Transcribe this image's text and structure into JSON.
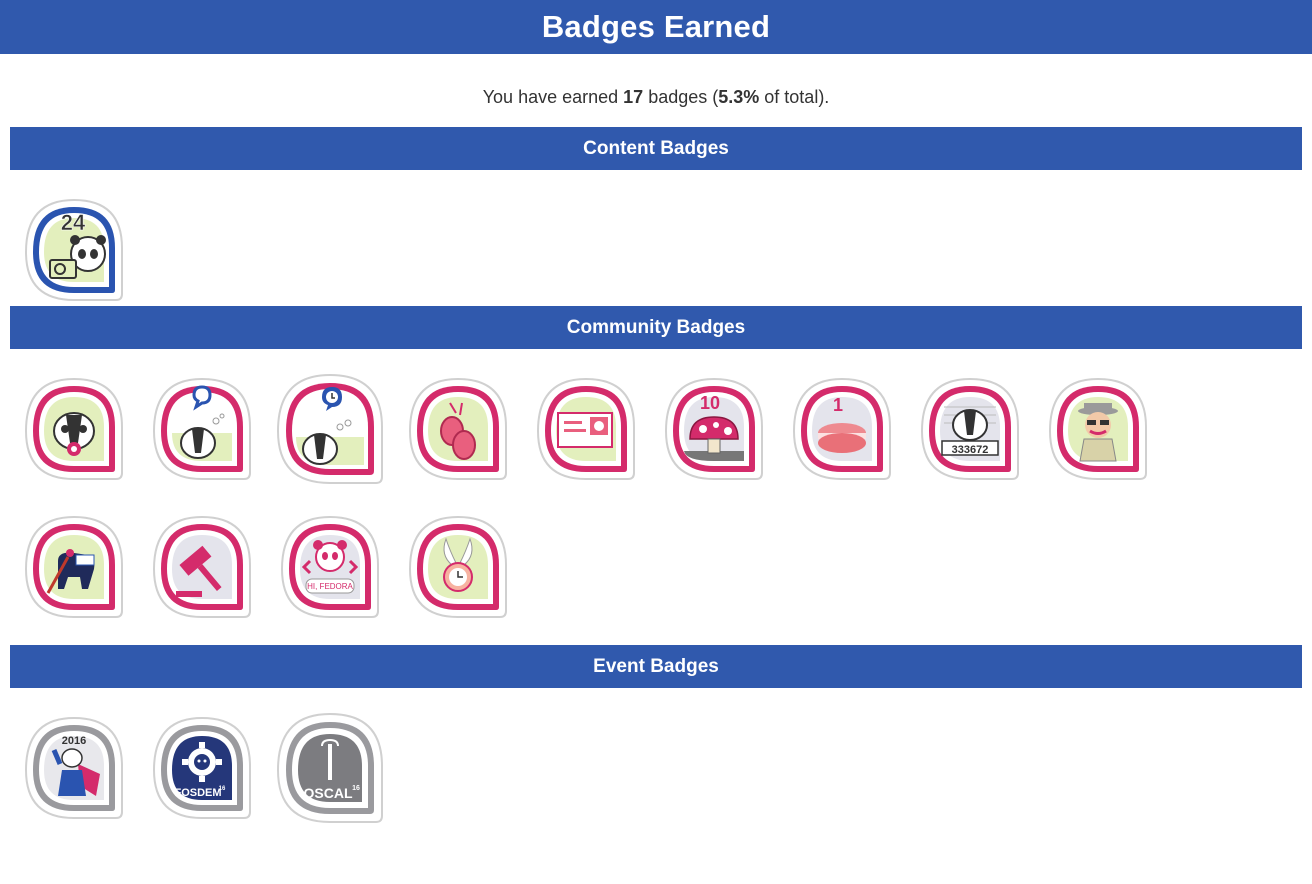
{
  "header": {
    "title": "Badges Earned"
  },
  "summary": {
    "prefix": "You have earned ",
    "count": "17",
    "middle": " badges (",
    "percent": "5.3%",
    "suffix": " of total)."
  },
  "sections": {
    "content": {
      "title": "Content Badges"
    },
    "community": {
      "title": "Community Badges"
    },
    "event": {
      "title": "Event Badges"
    }
  },
  "badge_text": {
    "camera_count": "24",
    "mushroom_count": "10",
    "macaron_count": "1",
    "mugshot_number": "333672",
    "hi_fedora": "HI, FEDORA",
    "flock_year": "2016",
    "fosdem": "FOSDEM",
    "fosdem_year": "16",
    "oscal": "OSCAL",
    "oscal_year": "16"
  },
  "colors": {
    "header_blue": "#3059ad",
    "content_ring": "#2a54b0",
    "community_ring": "#d42b6b",
    "event_ring": "#9a9a9e",
    "badge_fill_green": "#e3efbd"
  }
}
